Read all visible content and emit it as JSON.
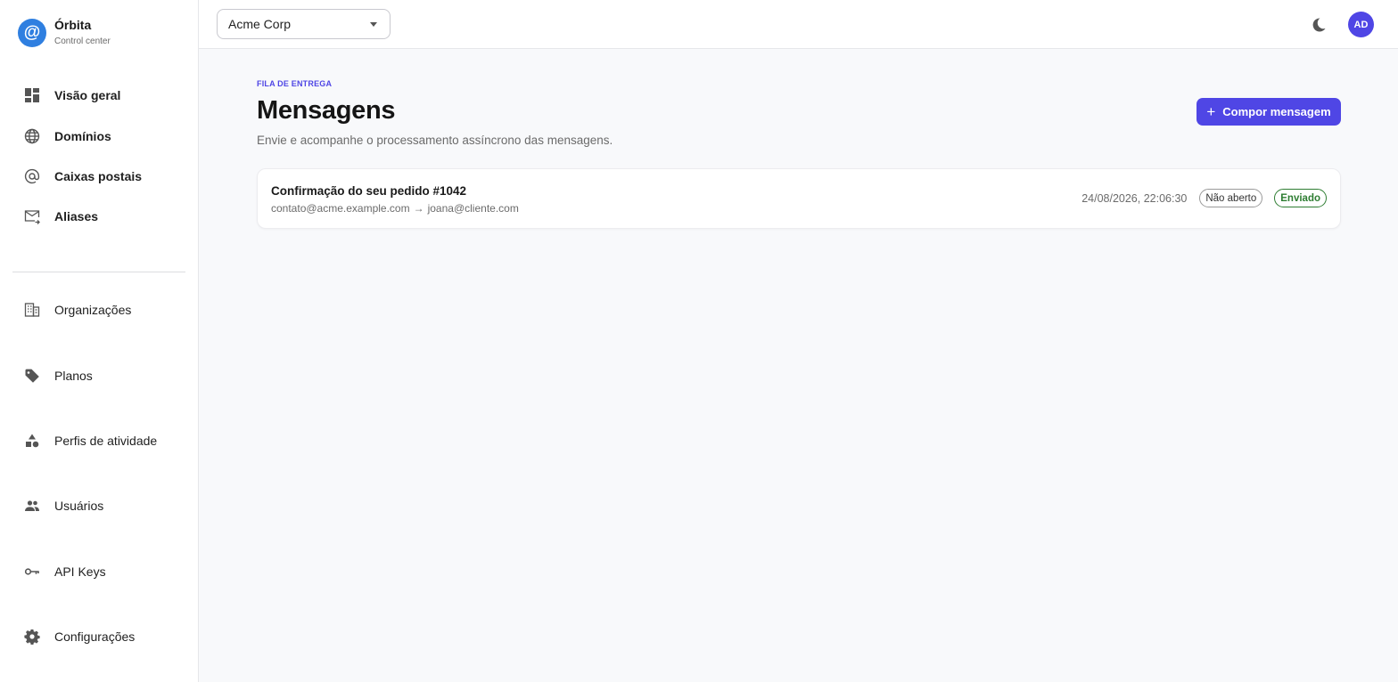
{
  "brand": {
    "name": "Órbita",
    "subtitle": "Control center",
    "logo_glyph": "@",
    "logo_color": "#2f7fe0"
  },
  "sidebar": {
    "primary_items": [
      {
        "label": "Visão geral",
        "icon": "dashboard-icon"
      },
      {
        "label": "Domínios",
        "icon": "globe-icon"
      },
      {
        "label": "Caixas postais",
        "icon": "at-icon"
      },
      {
        "label": "Aliases",
        "icon": "mail-forward-icon"
      }
    ],
    "admin_items": [
      {
        "label": "Organizações",
        "icon": "building-icon"
      },
      {
        "label": "Planos",
        "icon": "tag-icon"
      },
      {
        "label": "Perfis de atividade",
        "icon": "shapes-icon"
      },
      {
        "label": "Usuários",
        "icon": "users-icon"
      },
      {
        "label": "API Keys",
        "icon": "key-icon"
      },
      {
        "label": "Configurações",
        "icon": "gear-icon"
      }
    ]
  },
  "topbar": {
    "org_select": {
      "value": "Acme Corp"
    },
    "theme_toggle_icon": "moon-icon",
    "avatar_initials": "AD",
    "accent": "#4f46e5"
  },
  "page": {
    "eyebrow": "FILA DE ENTREGA",
    "title": "Mensagens",
    "description": "Envie e acompanhe o processamento assíncrono das mensagens.",
    "compose_button": {
      "icon": "plus",
      "label": "Compor mensagem"
    }
  },
  "messages": [
    {
      "subject": "Confirmação do seu pedido #1042",
      "from": "contato@acme.example.com",
      "arrow": "→",
      "to": "joana@cliente.com",
      "timestamp": "24/08/2026, 22:06:30",
      "open_status": "Não aberto",
      "delivery_status": "Enviado",
      "delivery_status_color": "#2e7d32"
    }
  ]
}
